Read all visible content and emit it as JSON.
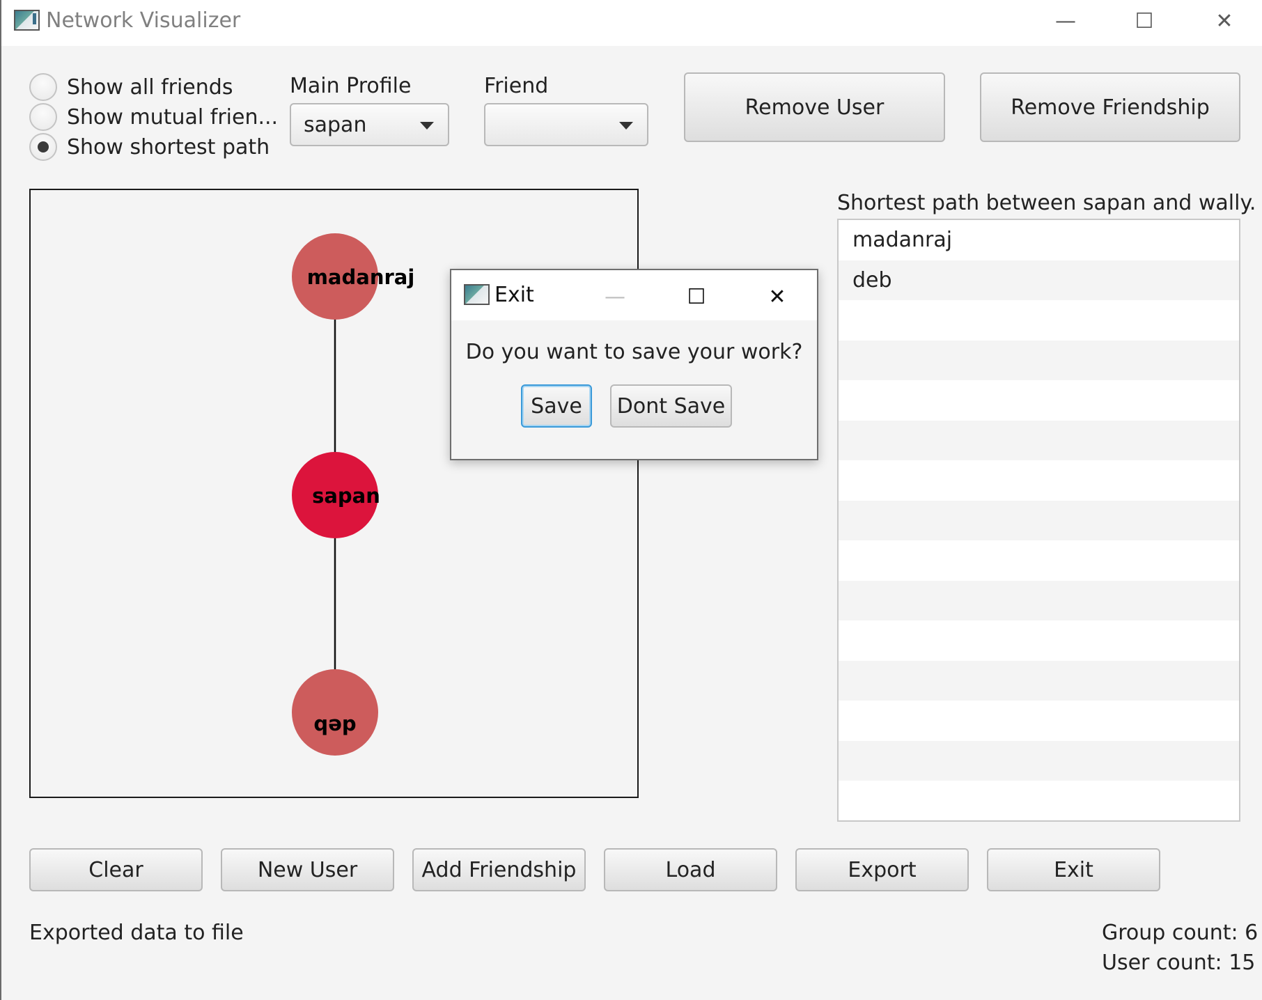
{
  "window": {
    "title": "Network Visualizer",
    "minimize": "—",
    "maximize": "☐",
    "close": "✕"
  },
  "view_modes": [
    {
      "label": "Show all friends",
      "selected": false
    },
    {
      "label": "Show mutual frien...",
      "selected": false
    },
    {
      "label": "Show shortest path",
      "selected": true
    }
  ],
  "main_profile": {
    "label": "Main Profile",
    "value": "sapan"
  },
  "friend": {
    "label": "Friend",
    "value": ""
  },
  "top_buttons": {
    "remove_user": "Remove User",
    "remove_friendship": "Remove Friendship"
  },
  "graph": {
    "nodes": [
      {
        "name": "madanraj",
        "color": "#cd5c5c"
      },
      {
        "name": "sapan",
        "color": "#dc143c"
      },
      {
        "name": "deb",
        "color": "#cd5c5c"
      }
    ],
    "edges": [
      [
        "madanraj",
        "sapan"
      ],
      [
        "sapan",
        "deb"
      ]
    ]
  },
  "path_list": {
    "title": "Shortest path between sapan and wally.",
    "items": [
      "madanraj",
      "deb",
      "",
      "",
      "",
      "",
      "",
      "",
      "",
      "",
      "",
      "",
      "",
      "",
      ""
    ]
  },
  "bottom_buttons": {
    "clear": "Clear",
    "new_user": "New User",
    "add_friendship": "Add Friendship",
    "load": "Load",
    "export": "Export",
    "exit": "Exit"
  },
  "status": {
    "message": "Exported data to file",
    "group_count": "Group count: 6",
    "user_count": "User count: 15"
  },
  "dialog": {
    "title": "Exit",
    "message": "Do you want to save your work?",
    "save": "Save",
    "dont_save": "Dont Save",
    "minimize": "—",
    "maximize": "☐",
    "close": "✕"
  }
}
